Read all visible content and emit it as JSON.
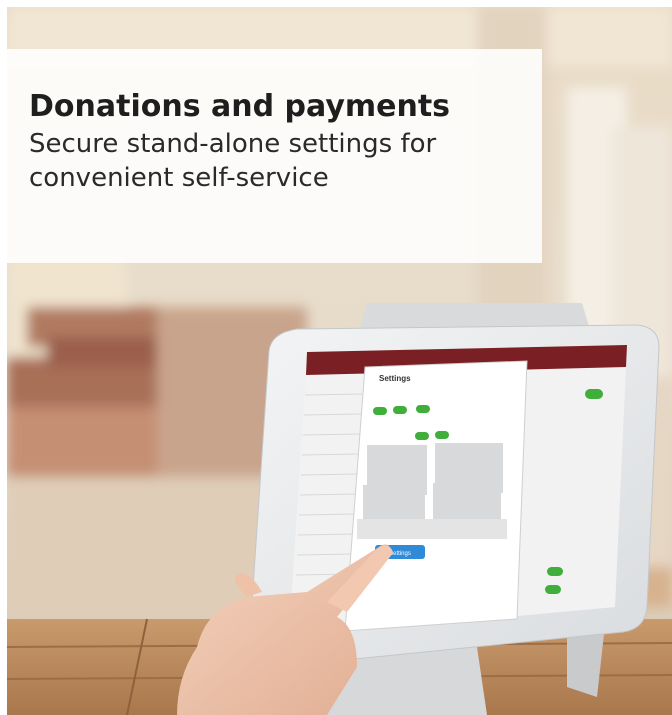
{
  "headline": {
    "title": "Donations and payments",
    "subtitle": "Secure stand-alone settings for convenient self-service"
  },
  "tablet_screen": {
    "dialog_title": "Settings",
    "save_button_label": "Settings"
  },
  "colors": {
    "app_header": "#7a1f24",
    "toggle_green": "#3fae3a",
    "accent_blue": "#2f8ad8",
    "wood": "#b98a5e"
  }
}
